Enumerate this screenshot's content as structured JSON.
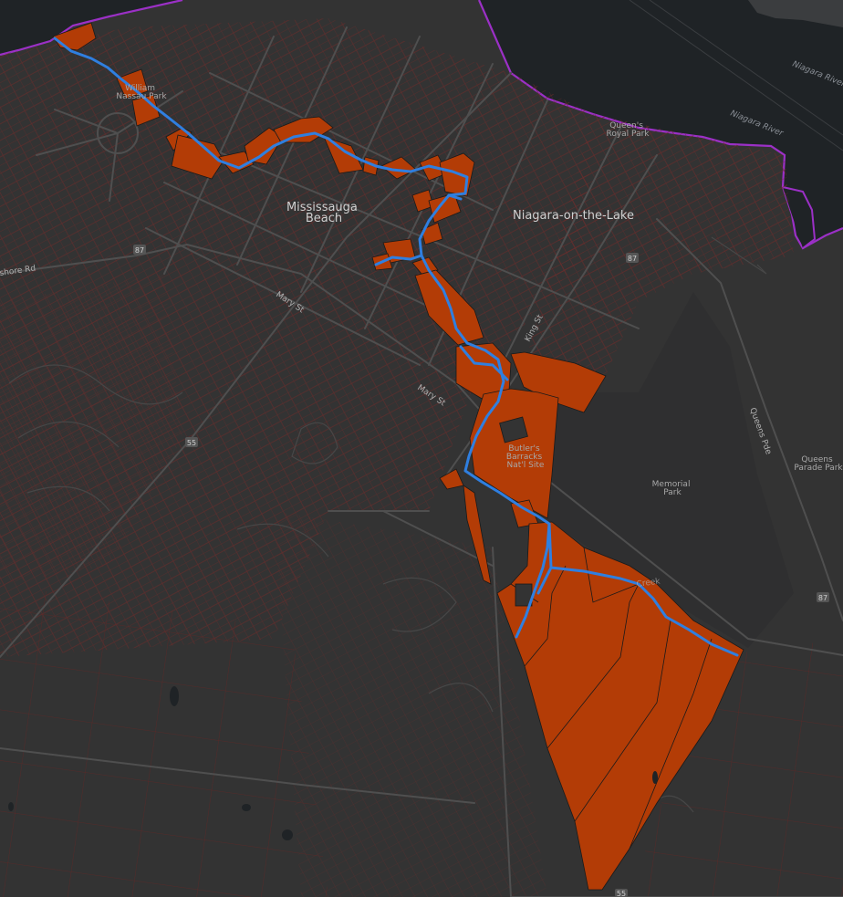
{
  "map": {
    "theme": "dark-gray",
    "colors": {
      "land": "#333333",
      "land_shade": "#2e2e2e",
      "water": "#1f2326",
      "shoreline": "#9b30c6",
      "roads": "#4d4d4d",
      "parcel_lines": "#6b2c2a",
      "highlight_fill": "#b33c06",
      "highlight_stroke": "#1a1a1a",
      "stream": "#2f7fe0",
      "text": "#cfcfcf"
    },
    "places": {
      "town": "Niagara-on-the-Lake",
      "neighbourhood": "Mississauga\nBeach",
      "park_nassau": "William\nNassau Park",
      "park_queens_royal": "Queen's\nRoyal Park",
      "site_butlers": "Butler's\nBarracks\nNat'l Site",
      "park_memorial": "Memorial\nPark",
      "park_queens_parade": "Queens\nParade Park"
    },
    "water_labels": [
      "Niagara River",
      "Niagara River"
    ],
    "roads": {
      "mary_st_1": "Mary St",
      "mary_st_2": "Mary St",
      "king_st": "King St",
      "queens_pde": "Queens Pde",
      "shore_rd": "shore Rd",
      "creek": "Creek"
    },
    "route_shields": [
      "87",
      "87",
      "55",
      "87",
      "55"
    ]
  }
}
